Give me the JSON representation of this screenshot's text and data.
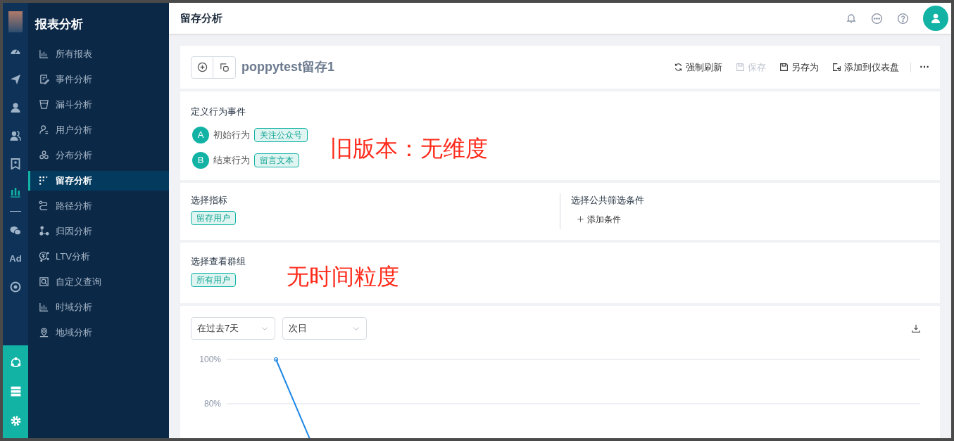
{
  "rail": {
    "items": [
      {
        "kind": "dashboard",
        "selected": false
      },
      {
        "kind": "send",
        "selected": false
      },
      {
        "kind": "user",
        "selected": false
      },
      {
        "kind": "users",
        "selected": false
      },
      {
        "kind": "bookmark",
        "selected": false
      },
      {
        "kind": "chart",
        "selected": true
      },
      {
        "kind": "divider",
        "selected": false
      },
      {
        "kind": "chat",
        "selected": false
      },
      {
        "kind": "text",
        "label": "Ad",
        "selected": false
      },
      {
        "kind": "disc",
        "selected": false
      }
    ],
    "bottom": [
      {
        "kind": "network"
      },
      {
        "kind": "server"
      },
      {
        "kind": "gear"
      }
    ]
  },
  "nav": {
    "title": "报表分析",
    "items": [
      {
        "label": "所有报表",
        "selected": false
      },
      {
        "label": "事件分析",
        "selected": false
      },
      {
        "label": "漏斗分析",
        "selected": false
      },
      {
        "label": "用户分析",
        "selected": false
      },
      {
        "label": "分布分析",
        "selected": false
      },
      {
        "label": "留存分析",
        "selected": true
      },
      {
        "label": "路径分析",
        "selected": false
      },
      {
        "label": "归因分析",
        "selected": false
      },
      {
        "label": "LTV分析",
        "selected": false
      },
      {
        "label": "自定义查询",
        "selected": false
      },
      {
        "label": "时域分析",
        "selected": false
      },
      {
        "label": "地域分析",
        "selected": false
      }
    ]
  },
  "header": {
    "title": "留存分析"
  },
  "toolbar": {
    "report_name": "poppytest留存1",
    "actions": [
      {
        "label": "强制刷新",
        "disabled": false
      },
      {
        "label": "保存",
        "disabled": true
      },
      {
        "label": "另存为",
        "disabled": false
      },
      {
        "label": "添加到仪表盘",
        "disabled": false
      }
    ],
    "more": "⋯"
  },
  "events": {
    "title": "定义行为事件",
    "rows": [
      {
        "badge": "A",
        "label": "初始行为",
        "tag": "关注公众号"
      },
      {
        "badge": "B",
        "label": "结束行为",
        "tag": "留言文本"
      }
    ]
  },
  "metrics": {
    "title": "选择指标",
    "tag": "留存用户"
  },
  "filters": {
    "title": "选择公共筛选条件",
    "add": "添加条件"
  },
  "group": {
    "title": "选择查看群组",
    "tag": "所有用户"
  },
  "annotations": [
    "旧版本：无维度",
    "无时间粒度"
  ],
  "chart": {
    "dropdowns": [
      "在过去7天",
      "次日"
    ],
    "axis_labels": [
      "100%",
      "80%"
    ]
  }
}
